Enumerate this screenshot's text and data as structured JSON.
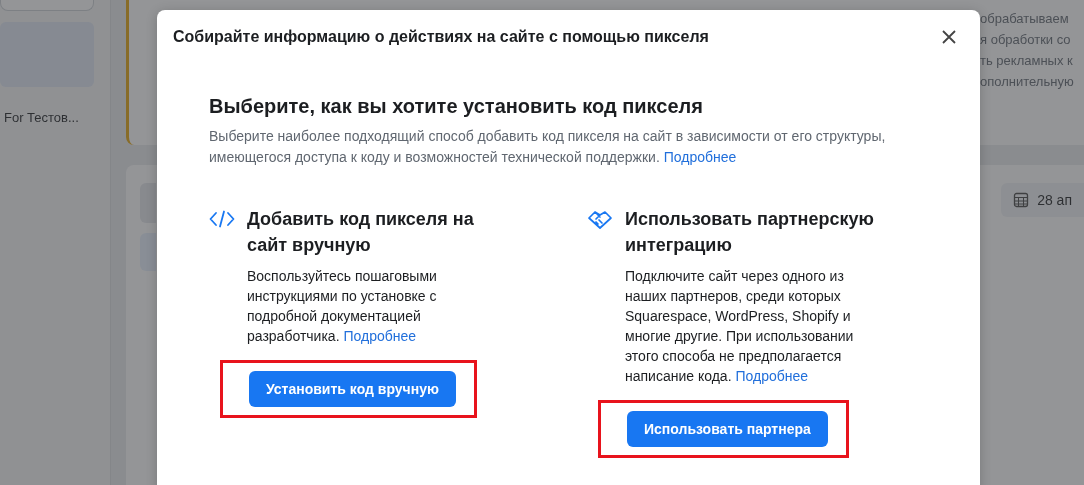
{
  "background": {
    "sidebar": {
      "account_label": "For Тестов..."
    },
    "notice_lines": [
      "обрабатываем",
      "я обработки со",
      "ть рекламных к",
      "ополнительную"
    ],
    "date_button": "28 ап"
  },
  "modal": {
    "title": "Собирайте информацию о действиях на сайте с помощью пикселя",
    "heading": "Выберите, как вы хотите установить код пикселя",
    "description": "Выберите наиболее подходящий способ добавить код пикселя на сайт в зависимости от его структуры, имеющегося доступа к коду и возможностей технической поддержки.",
    "description_link": "Подробнее",
    "options": [
      {
        "kind": "code",
        "title": "Добавить код пикселя на сайт вручную",
        "text": "Воспользуйтесь пошаговыми инструкциями по установке с подробной документацией разработчика.",
        "link": "Подробнее",
        "button": "Установить код вручную",
        "highlighted": true
      },
      {
        "kind": "partner",
        "title": "Использовать партнерскую интеграцию",
        "text": "Подключите сайт через одного из наших партнеров, среди которых Squarespace, WordPress, Shopify и многие другие. При использовании этого способа не предполагается написание кода.",
        "link": "Подробнее",
        "button": "Использовать партнера",
        "highlighted": true
      }
    ]
  }
}
